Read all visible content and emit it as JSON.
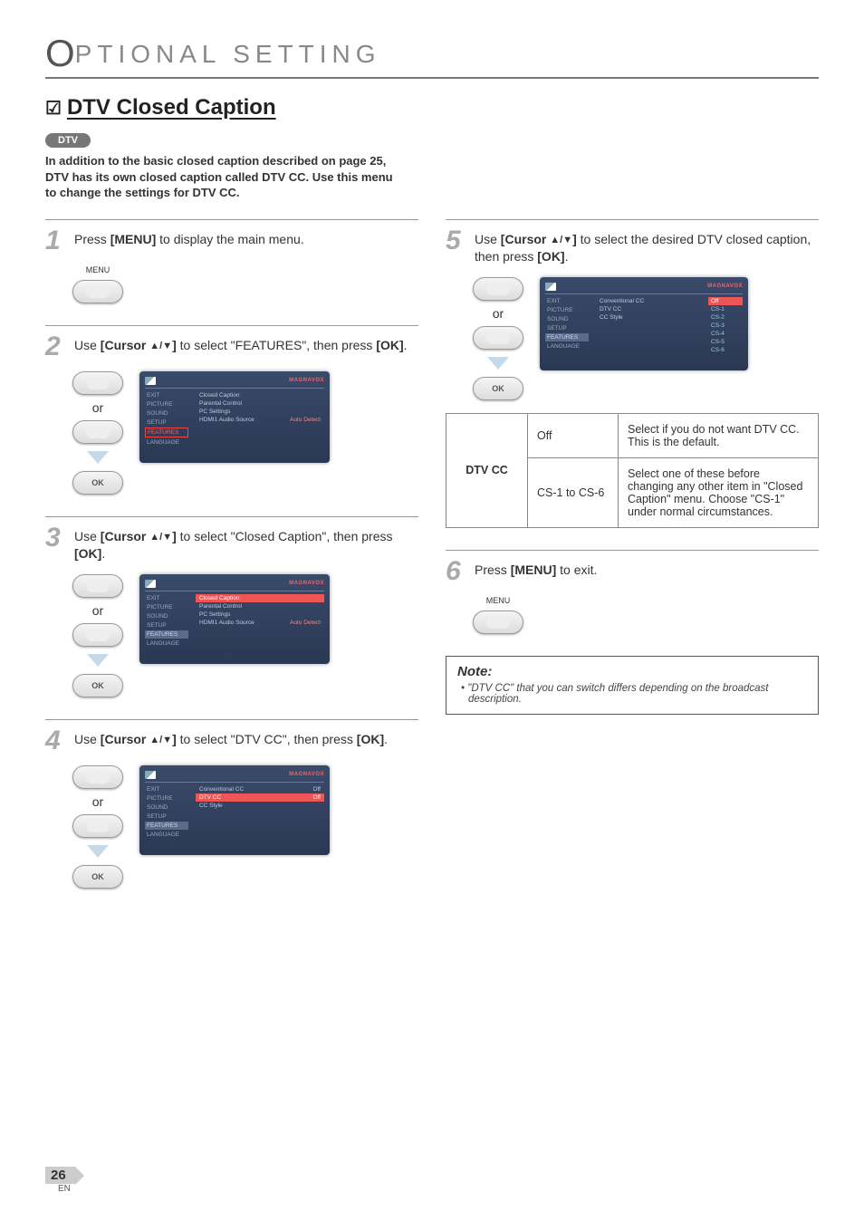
{
  "header": {
    "big_letter": "O",
    "rest": "PTIONAL   SETTING"
  },
  "section": {
    "checkbox": "☑",
    "title": "DTV Closed Caption"
  },
  "badge": "DTV",
  "intro": "In addition to the basic closed caption described on page 25, DTV has its own closed caption called DTV CC. Use this menu to change the settings for DTV CC.",
  "steps": {
    "s1": {
      "num": "1",
      "text_pre": "Press ",
      "bold1": "[MENU]",
      "text_post": " to display the main menu.",
      "btn_label": "MENU"
    },
    "s2": {
      "num": "2",
      "text_pre": "Use ",
      "bold1": "[Cursor ",
      "arrows": "▲/▼",
      "bold1b": "]",
      "text_mid": " to select \"FEATURES\", then press ",
      "bold2": "[OK]",
      "text_post": ".",
      "or": "or",
      "ok": "OK"
    },
    "s3": {
      "num": "3",
      "text_pre": "Use ",
      "bold1": "[Cursor ",
      "arrows": "▲/▼",
      "bold1b": "]",
      "text_mid": " to select \"Closed Caption\", then press ",
      "bold2": "[OK]",
      "text_post": ".",
      "or": "or",
      "ok": "OK"
    },
    "s4": {
      "num": "4",
      "text_pre": "Use ",
      "bold1": "[Cursor ",
      "arrows": "▲/▼",
      "bold1b": "]",
      "text_mid": " to select \"DTV CC\", then press ",
      "bold2": "[OK]",
      "text_post": ".",
      "or": "or",
      "ok": "OK"
    },
    "s5": {
      "num": "5",
      "text_pre": "Use ",
      "bold1": "[Cursor ",
      "arrows": "▲/▼",
      "bold1b": "]",
      "text_mid": " to select the desired DTV closed caption, then press ",
      "bold2": "[OK]",
      "text_post": ".",
      "or": "or",
      "ok": "OK"
    },
    "s6": {
      "num": "6",
      "text_pre": "Press ",
      "bold1": "[MENU]",
      "text_post": " to exit.",
      "btn_label": "MENU"
    }
  },
  "tv": {
    "brand": "MAGNAVOX",
    "side": [
      "EXIT",
      "PICTURE",
      "SOUND",
      "SETUP",
      "FEATURES",
      "LANGUAGE"
    ],
    "features_rows": [
      {
        "l": "Closed Caption",
        "r": ""
      },
      {
        "l": "Parental Control",
        "r": ""
      },
      {
        "l": "PC Settings",
        "r": ""
      },
      {
        "l": "HDMI1 Audio Source",
        "r": "Auto Detect"
      }
    ],
    "cc_rows": [
      {
        "l": "Conventional CC",
        "r": "Off"
      },
      {
        "l": "DTV CC",
        "r": "Off"
      },
      {
        "l": "CC Style",
        "r": ""
      }
    ],
    "dtvcc_rows": [
      {
        "l": "Conventional CC",
        "r": ""
      },
      {
        "l": "DTV CC",
        "r": ""
      },
      {
        "l": "CC Style",
        "r": ""
      }
    ],
    "dtvcc_options": [
      "Off",
      "CS-1",
      "CS-2",
      "CS-3",
      "CS-4",
      "CS-5",
      "CS-6"
    ]
  },
  "table": {
    "rowhead": "DTV CC",
    "r1_opt": "Off",
    "r1_desc": "Select if you do not want DTV CC. This is the default.",
    "r2_opt": "CS-1 to CS-6",
    "r2_desc": "Select one of these before changing any other item in \"Closed Caption\" menu. Choose \"CS-1\" under normal circumstances."
  },
  "note": {
    "title": "Note:",
    "bullet": "• ",
    "body": "\"DTV CC\" that you can switch differs depending on the broadcast description."
  },
  "footer": {
    "page": "26",
    "lang": "EN"
  }
}
